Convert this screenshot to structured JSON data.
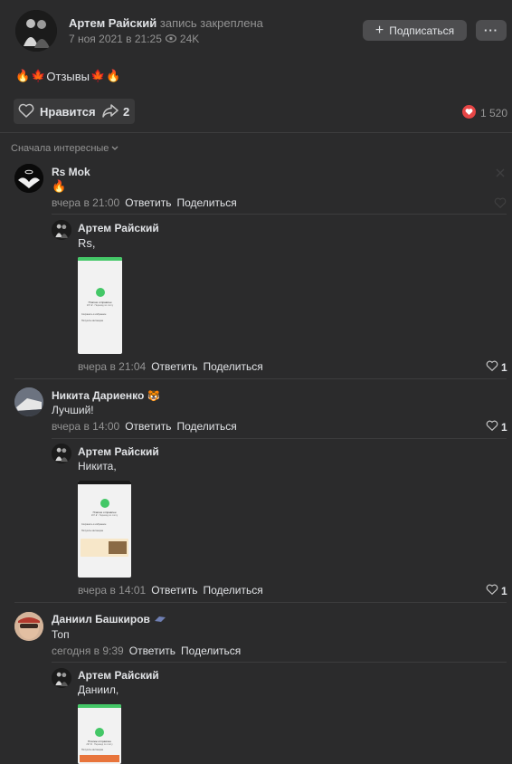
{
  "post": {
    "author": "Артем Райский",
    "pinned_note": "запись закреплена",
    "date": "7 ноя 2021 в 21:25",
    "views": "24K",
    "subscribe_label": "Подписаться",
    "more_label": "···",
    "text": "Отзывы",
    "like_label": "Нравится",
    "share_count": "2",
    "reactions_count": "1 520"
  },
  "comments_sort": "Сначала интересные",
  "actions": {
    "reply": "Ответить",
    "share": "Поделиться"
  },
  "comments": [
    {
      "author": "Rs Mok",
      "text": "🔥",
      "time": "вчера в 21:00",
      "reply": {
        "author": "Артем Райский",
        "text": "Rs,",
        "time": "вчера в 21:04",
        "likes": "1"
      }
    },
    {
      "author": "Никита Дариенко",
      "badge": "🐯",
      "text": "Лучший!",
      "time": "вчера в 14:00",
      "likes": "1",
      "reply": {
        "author": "Артем Райский",
        "text": "Никита,",
        "time": "вчера в 14:01",
        "likes": "1"
      }
    },
    {
      "author": "Даниил Башкиров",
      "text": "Топ",
      "time": "сегодня в 9:39",
      "reply": {
        "author": "Артем Райский",
        "text": "Даниил,"
      }
    }
  ],
  "thumb_texts": {
    "payment_title": "Платеж отправлен",
    "payment_sub": "297 ₽ · Перевод по счёту",
    "row1": "Сохранить в избранное",
    "row2": "Получить квитанцию"
  }
}
